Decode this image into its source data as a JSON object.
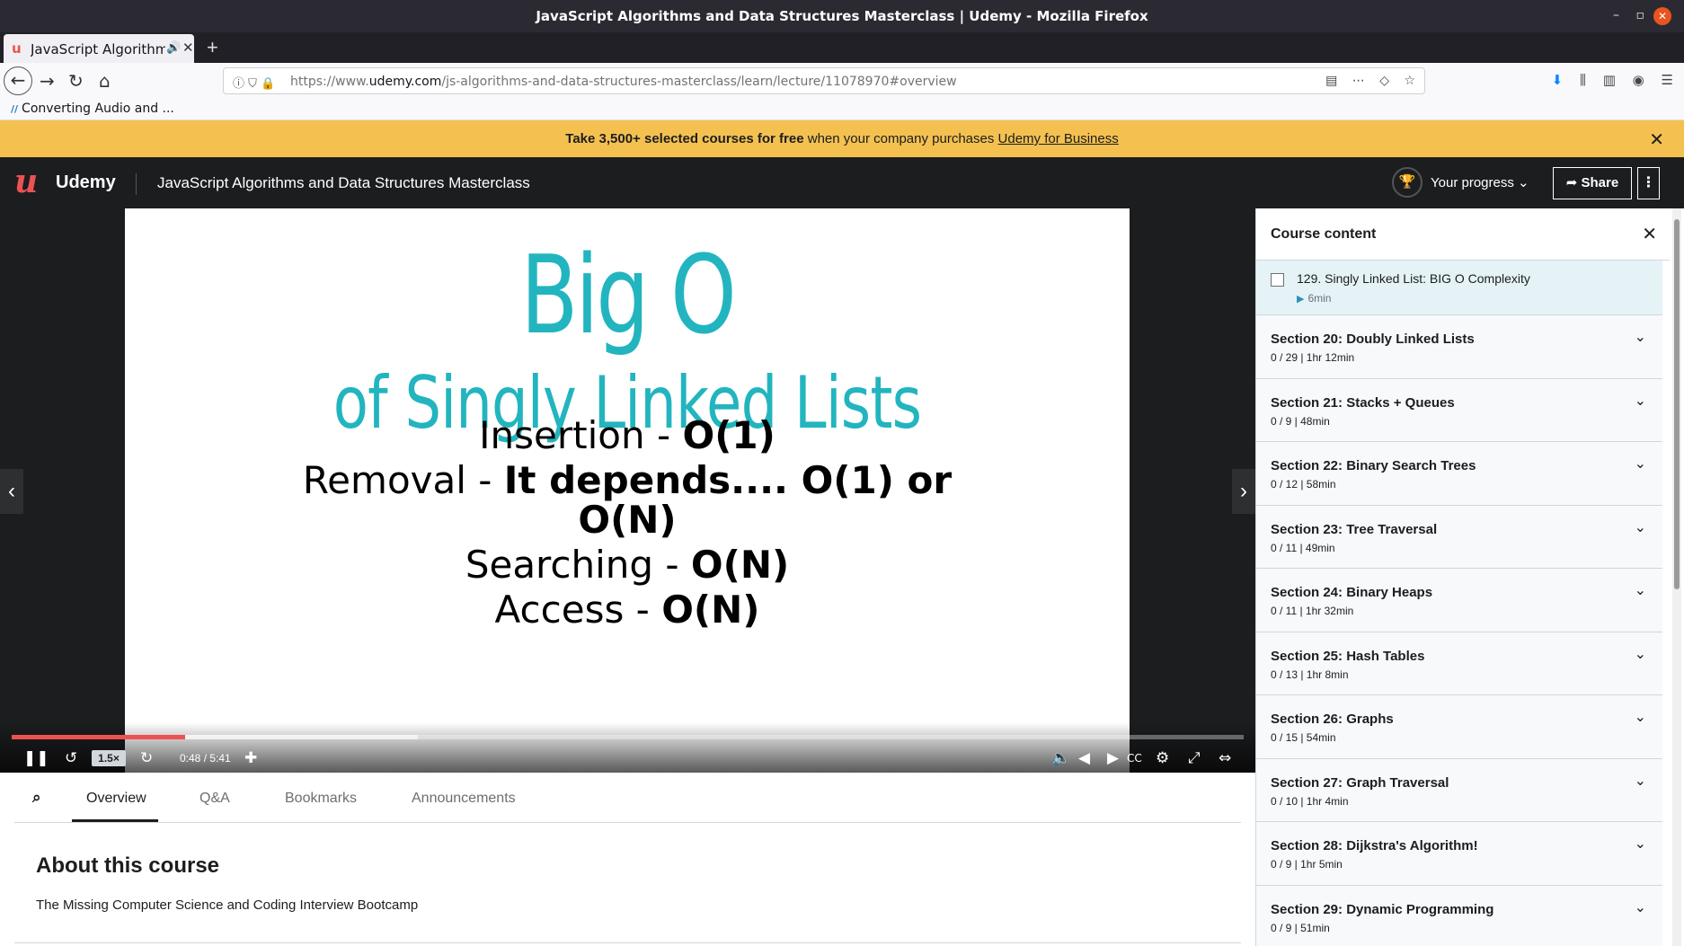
{
  "browser": {
    "window_title": "JavaScript Algorithms and Data Structures Masterclass | Udemy - Mozilla Firefox",
    "tab_label": "JavaScript Algorithms",
    "url_prefix": "https://www.",
    "url_host": "udemy.com",
    "url_path": "/js-algorithms-and-data-structures-masterclass/learn/lecture/11078970#overview",
    "bookmark_label": "Converting Audio and ..."
  },
  "banner": {
    "strong": "Take 3,500+ selected courses for free",
    "middle": " when your company purchases ",
    "link": "Udemy for Business"
  },
  "header": {
    "logo": "Udemy",
    "course_title": "JavaScript Algorithms and Data Structures Masterclass",
    "progress_label": "Your progress",
    "share_label": "Share"
  },
  "slide": {
    "title": "Big O",
    "subtitle": "of Singly Linked Lists",
    "rows": [
      {
        "label": "Insertion - ",
        "value": "O(1)"
      },
      {
        "label": "Removal - ",
        "value": "It depends.... O(1) or"
      },
      {
        "label": "",
        "value": "O(N)"
      },
      {
        "label": "Searching - ",
        "value": "O(N)"
      },
      {
        "label": "Access - ",
        "value": "O(N)"
      }
    ]
  },
  "player": {
    "speed": "1.5×",
    "time": "0:48 / 5:41",
    "played_fraction": 0.141,
    "buffered_fraction": 0.33
  },
  "tabs": {
    "overview": "Overview",
    "qa": "Q&A",
    "bookmarks": "Bookmarks",
    "announcements": "Announcements"
  },
  "about": {
    "heading": "About this course",
    "text": "The Missing Computer Science and Coding Interview Bootcamp"
  },
  "sidebar": {
    "title": "Course content",
    "current_lecture": {
      "title": "129. Singly Linked List: BIG O Complexity",
      "duration": "6min"
    },
    "sections": [
      {
        "title": "Section 20: Doubly Linked Lists",
        "meta": "0 / 29  |  1hr 12min"
      },
      {
        "title": "Section 21: Stacks + Queues",
        "meta": "0 / 9  |  48min"
      },
      {
        "title": "Section 22: Binary Search Trees",
        "meta": "0 / 12  |  58min"
      },
      {
        "title": "Section 23: Tree Traversal",
        "meta": "0 / 11  |  49min"
      },
      {
        "title": "Section 24: Binary Heaps",
        "meta": "0 / 11  |  1hr 32min"
      },
      {
        "title": "Section 25: Hash Tables",
        "meta": "0 / 13  |  1hr 8min"
      },
      {
        "title": "Section 26: Graphs",
        "meta": "0 / 15  |  54min"
      },
      {
        "title": "Section 27: Graph Traversal",
        "meta": "0 / 10  |  1hr 4min"
      },
      {
        "title": "Section 28: Dijkstra's Algorithm!",
        "meta": "0 / 9  |  1hr 5min"
      },
      {
        "title": "Section 29: Dynamic Programming",
        "meta": "0 / 9  |  51min"
      }
    ]
  },
  "colors": {
    "brand": "#ec5252",
    "banner": "#f4c150",
    "slide_title": "#22b5bf",
    "header_bg": "#1c1d1f"
  }
}
